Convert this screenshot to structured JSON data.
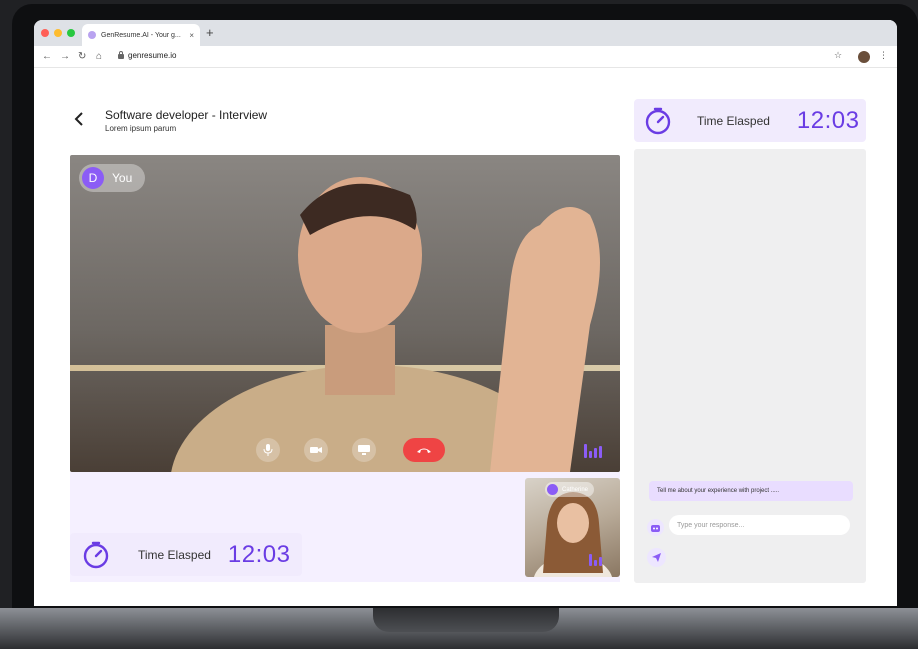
{
  "browser": {
    "tab_title": "GenResume.AI - Your g...",
    "tab_close": "×",
    "new_tab": "+",
    "url": "genresume.io",
    "colors": {
      "close": "#ff5f57",
      "minimize": "#febc2e",
      "zoom": "#28c840"
    }
  },
  "header": {
    "back_icon": "chevron-left-icon",
    "title": "Software developer - Interview",
    "subtitle": "Lorem ipsum parum"
  },
  "timer": {
    "label": "Time Elasped",
    "value": "12:03",
    "icon": "stopwatch-icon"
  },
  "video": {
    "user_initial": "D",
    "user_label": "You",
    "controls": [
      "mic-icon",
      "camera-icon",
      "screen-share-icon",
      "end-call-icon"
    ]
  },
  "interviewer": {
    "name": "Catherine"
  },
  "chat": {
    "message": "Tell me about your experience with project .....",
    "input_placeholder": "Type your response..."
  },
  "colors": {
    "accent": "#8b5cf6",
    "accent_dark": "#6a3ce4",
    "lilac_bg": "#f5f0ff",
    "end_call": "#ef4444"
  }
}
